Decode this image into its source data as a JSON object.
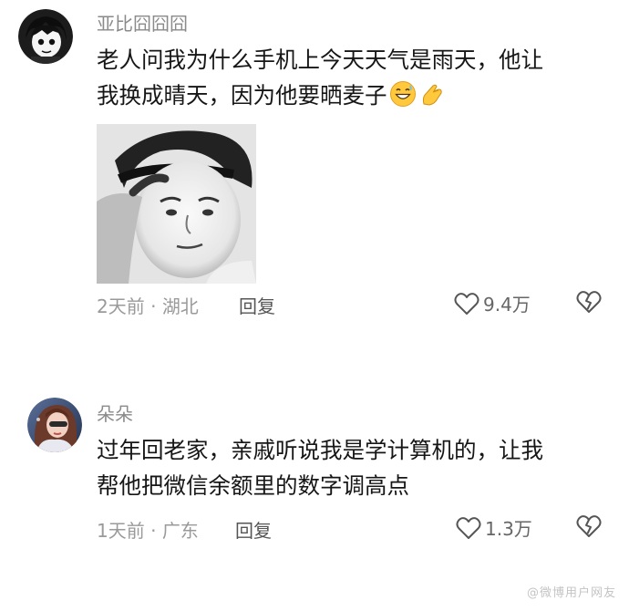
{
  "comments": [
    {
      "username": "亚比囧囧囧",
      "lines": [
        "老人问我为什么手机上今天天气是雨天，他让",
        "我换成晴天，因为他要晒麦子"
      ],
      "emojis": [
        "grinning-sweat-emoji",
        "pinching-hand-emoji"
      ],
      "time": "2天前",
      "separator": " · ",
      "location": "湖北",
      "reply_label": "回复",
      "likes": "9.4万",
      "has_image": true
    },
    {
      "username": "朵朵",
      "lines": [
        "过年回老家，亲戚听说我是学计算机的，让我",
        "帮他把微信余额里的数字调高点"
      ],
      "emojis": [],
      "time": "1天前",
      "separator": " · ",
      "location": "广东",
      "reply_label": "回复",
      "likes": "1.3万",
      "has_image": false
    }
  ],
  "watermark": "@微博用户网友"
}
